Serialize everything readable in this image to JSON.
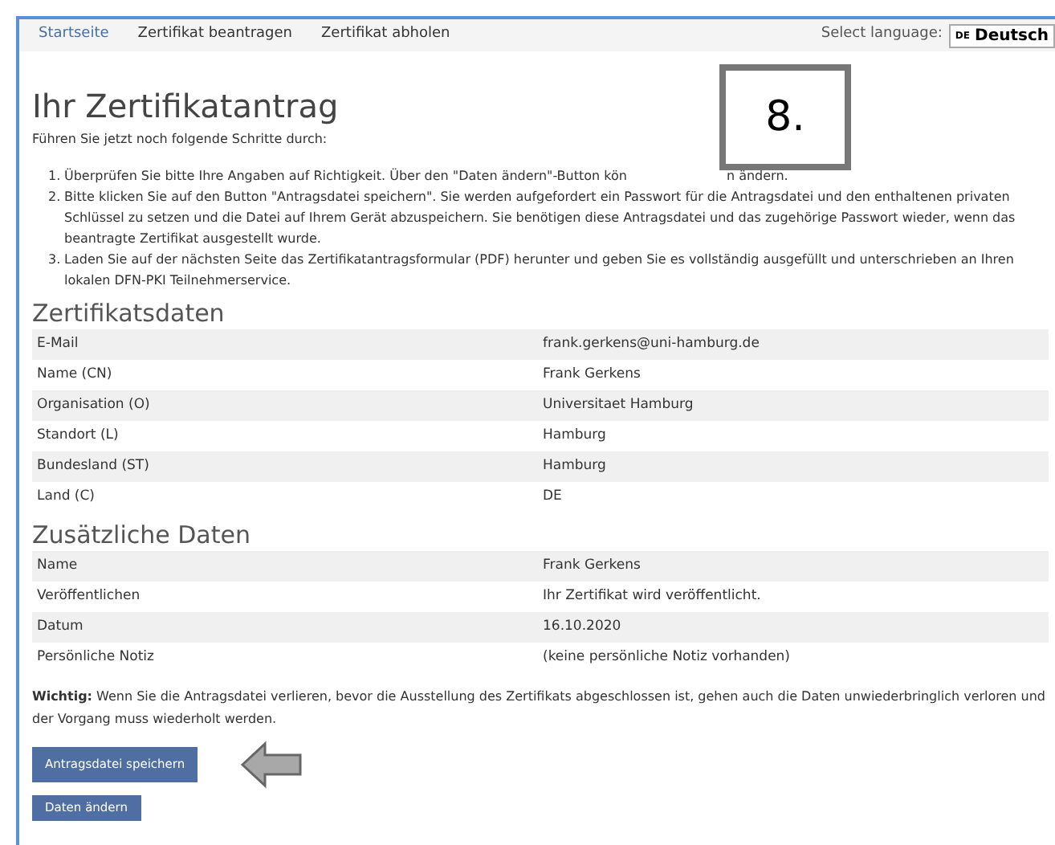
{
  "nav": {
    "items": [
      {
        "label": "Startseite",
        "selected": true
      },
      {
        "label": "Zertifikat beantragen",
        "selected": false
      },
      {
        "label": "Zertifikat abholen",
        "selected": false
      }
    ],
    "language_label": "Select language:",
    "language": {
      "code": "DE",
      "name": "Deutsch"
    }
  },
  "title": "Ihr Zertifikatantrag",
  "intro": "Führen Sie jetzt noch folgende Schritte durch:",
  "overlay_label": "8.",
  "steps": [
    {
      "number": "1.",
      "text": "Überprüfen Sie bitte Ihre Angaben auf Richtigkeit. Über den \"Daten ändern\"-Button kön",
      "text_after": "n ändern."
    },
    {
      "number": "2.",
      "text": "Bitte klicken Sie auf den Button \"Antragsdatei speichern\". Sie werden aufgefordert ein Passwort für die Antragsdatei und den enthaltenen privaten Schlüssel zu setzen und die Datei auf Ihrem Gerät abzuspeichern. Sie benötigen diese Antragsdatei und das zugehörige Passwort wieder, wenn das beantragte Zertifikat ausgestellt wurde."
    },
    {
      "number": "3.",
      "text": "Laden Sie auf der nächsten Seite das Zertifikatantragsformular (PDF) herunter und geben Sie es vollständig ausgefüllt und unterschrieben an Ihren lokalen DFN-PKI Teilnehmerservice."
    }
  ],
  "sections": [
    {
      "heading": "Zertifikatsdaten",
      "rows": [
        [
          "E-Mail",
          "frank.gerkens@uni-hamburg.de"
        ],
        [
          "Name (CN)",
          "Frank Gerkens"
        ],
        [
          "Organisation (O)",
          "Universitaet Hamburg"
        ],
        [
          "Standort (L)",
          "Hamburg"
        ],
        [
          "Bundesland (ST)",
          "Hamburg"
        ],
        [
          "Land (C)",
          "DE"
        ]
      ]
    },
    {
      "heading": "Zusätzliche Daten",
      "rows": [
        [
          "Name",
          "Frank Gerkens"
        ],
        [
          "Veröffentlichen",
          "Ihr Zertifikat wird veröffentlicht."
        ],
        [
          "Datum",
          "16.10.2020"
        ],
        [
          "Persönliche Notiz",
          "(keine persönliche Notiz vorhanden)"
        ]
      ]
    }
  ],
  "warning": "**Wichtig:** Wenn Sie die Antragsdatei verlieren, bevor die Ausstellung des Zertifikats abgeschlossen ist, gehen auch die Daten unwiederbringlich verloren und der Vorgang muss wiederholt werden.",
  "buttons": [
    "Antragsdatei speichern",
    "Daten ändern"
  ]
}
